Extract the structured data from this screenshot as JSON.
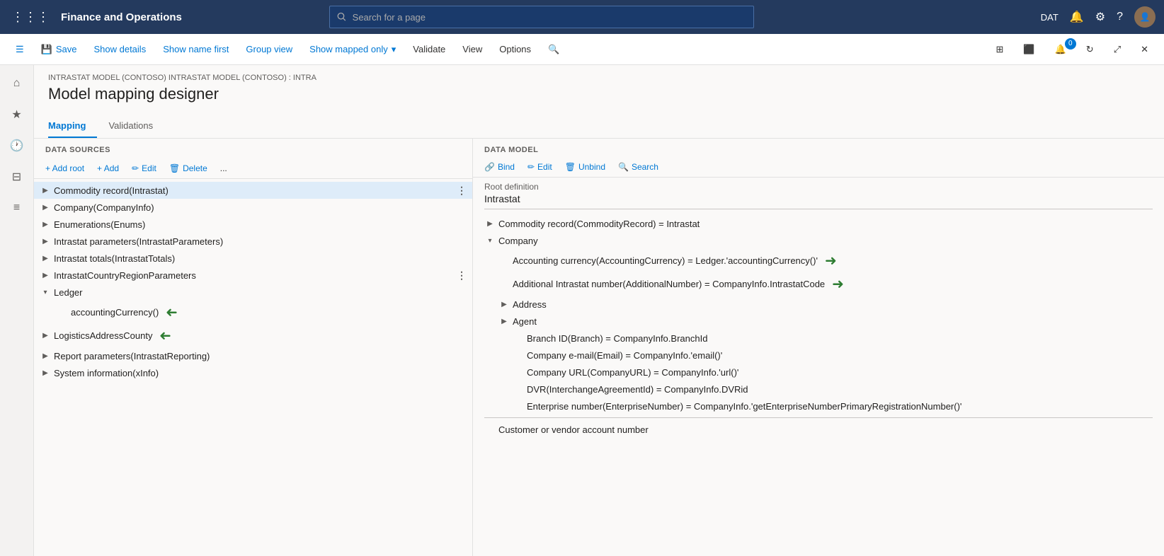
{
  "topnav": {
    "title": "Finance and Operations",
    "search_placeholder": "Search for a page",
    "env_label": "DAT"
  },
  "commandbar": {
    "save": "Save",
    "show_details": "Show details",
    "show_name_first": "Show name first",
    "group_view": "Group view",
    "show_mapped_only": "Show mapped only",
    "validate": "Validate",
    "view": "View",
    "options": "Options"
  },
  "breadcrumb": "INTRASTAT MODEL (CONTOSO) INTRASTAT MODEL (CONTOSO) : INTRA",
  "page_title": "Model mapping designer",
  "tabs": [
    {
      "label": "Mapping",
      "active": true
    },
    {
      "label": "Validations",
      "active": false
    }
  ],
  "left_pane": {
    "header": "DATA SOURCES",
    "toolbar": {
      "add_root": "+ Add root",
      "add": "+ Add",
      "edit": "Edit",
      "delete": "Delete",
      "more": "..."
    },
    "tree": [
      {
        "label": "Commodity record(Intrastat)",
        "level": 0,
        "expanded": false,
        "selected": true,
        "has_dots": true
      },
      {
        "label": "Company(CompanyInfo)",
        "level": 0,
        "expanded": false,
        "selected": false
      },
      {
        "label": "Enumerations(Enums)",
        "level": 0,
        "expanded": false,
        "selected": false
      },
      {
        "label": "Intrastat parameters(IntrastatParameters)",
        "level": 0,
        "expanded": false,
        "selected": false
      },
      {
        "label": "Intrastat totals(IntrastatTotals)",
        "level": 0,
        "expanded": false,
        "selected": false
      },
      {
        "label": "IntrastatCountryRegionParameters",
        "level": 0,
        "expanded": false,
        "selected": false,
        "has_dots": true
      },
      {
        "label": "Ledger",
        "level": 0,
        "expanded": true,
        "selected": false
      },
      {
        "label": "accountingCurrency()",
        "level": 1,
        "expanded": false,
        "selected": false,
        "has_arrow": true
      },
      {
        "label": "LogisticsAddressCounty",
        "level": 0,
        "expanded": false,
        "selected": false,
        "has_arrow": true
      },
      {
        "label": "Report parameters(IntrastatReporting)",
        "level": 0,
        "expanded": false,
        "selected": false
      },
      {
        "label": "System information(xInfo)",
        "level": 0,
        "expanded": false,
        "selected": false
      }
    ]
  },
  "right_pane": {
    "header": "DATA MODEL",
    "toolbar": {
      "bind": "Bind",
      "edit": "Edit",
      "unbind": "Unbind",
      "search": "Search"
    },
    "root_definition_label": "Root definition",
    "root_definition_value": "Intrastat",
    "tree": [
      {
        "label": "Commodity record(CommodityRecord) = Intrastat",
        "level": 0,
        "expanded": false
      },
      {
        "label": "Company",
        "level": 0,
        "expanded": true
      },
      {
        "label": "Accounting currency(AccountingCurrency) = Ledger.'accountingCurrency()'",
        "level": 1,
        "has_arrow": true
      },
      {
        "label": "Additional Intrastat number(AdditionalNumber) = CompanyInfo.IntrastatCode",
        "level": 1,
        "has_arrow": true
      },
      {
        "label": "Address",
        "level": 1,
        "expanded": false
      },
      {
        "label": "Agent",
        "level": 1,
        "expanded": false
      },
      {
        "label": "Branch ID(Branch) = CompanyInfo.BranchId",
        "level": 2
      },
      {
        "label": "Company e-mail(Email) = CompanyInfo.'email()'",
        "level": 2
      },
      {
        "label": "Company URL(CompanyURL) = CompanyInfo.'url()'",
        "level": 2
      },
      {
        "label": "DVR(InterchangeAgreementId) = CompanyInfo.DVRid",
        "level": 2
      },
      {
        "label": "Enterprise number(EnterpriseNumber) = CompanyInfo.'getEnterpriseNumberPrimaryRegistrationNumber()'",
        "level": 2
      }
    ],
    "footer_text": "Customer or vendor account number"
  }
}
